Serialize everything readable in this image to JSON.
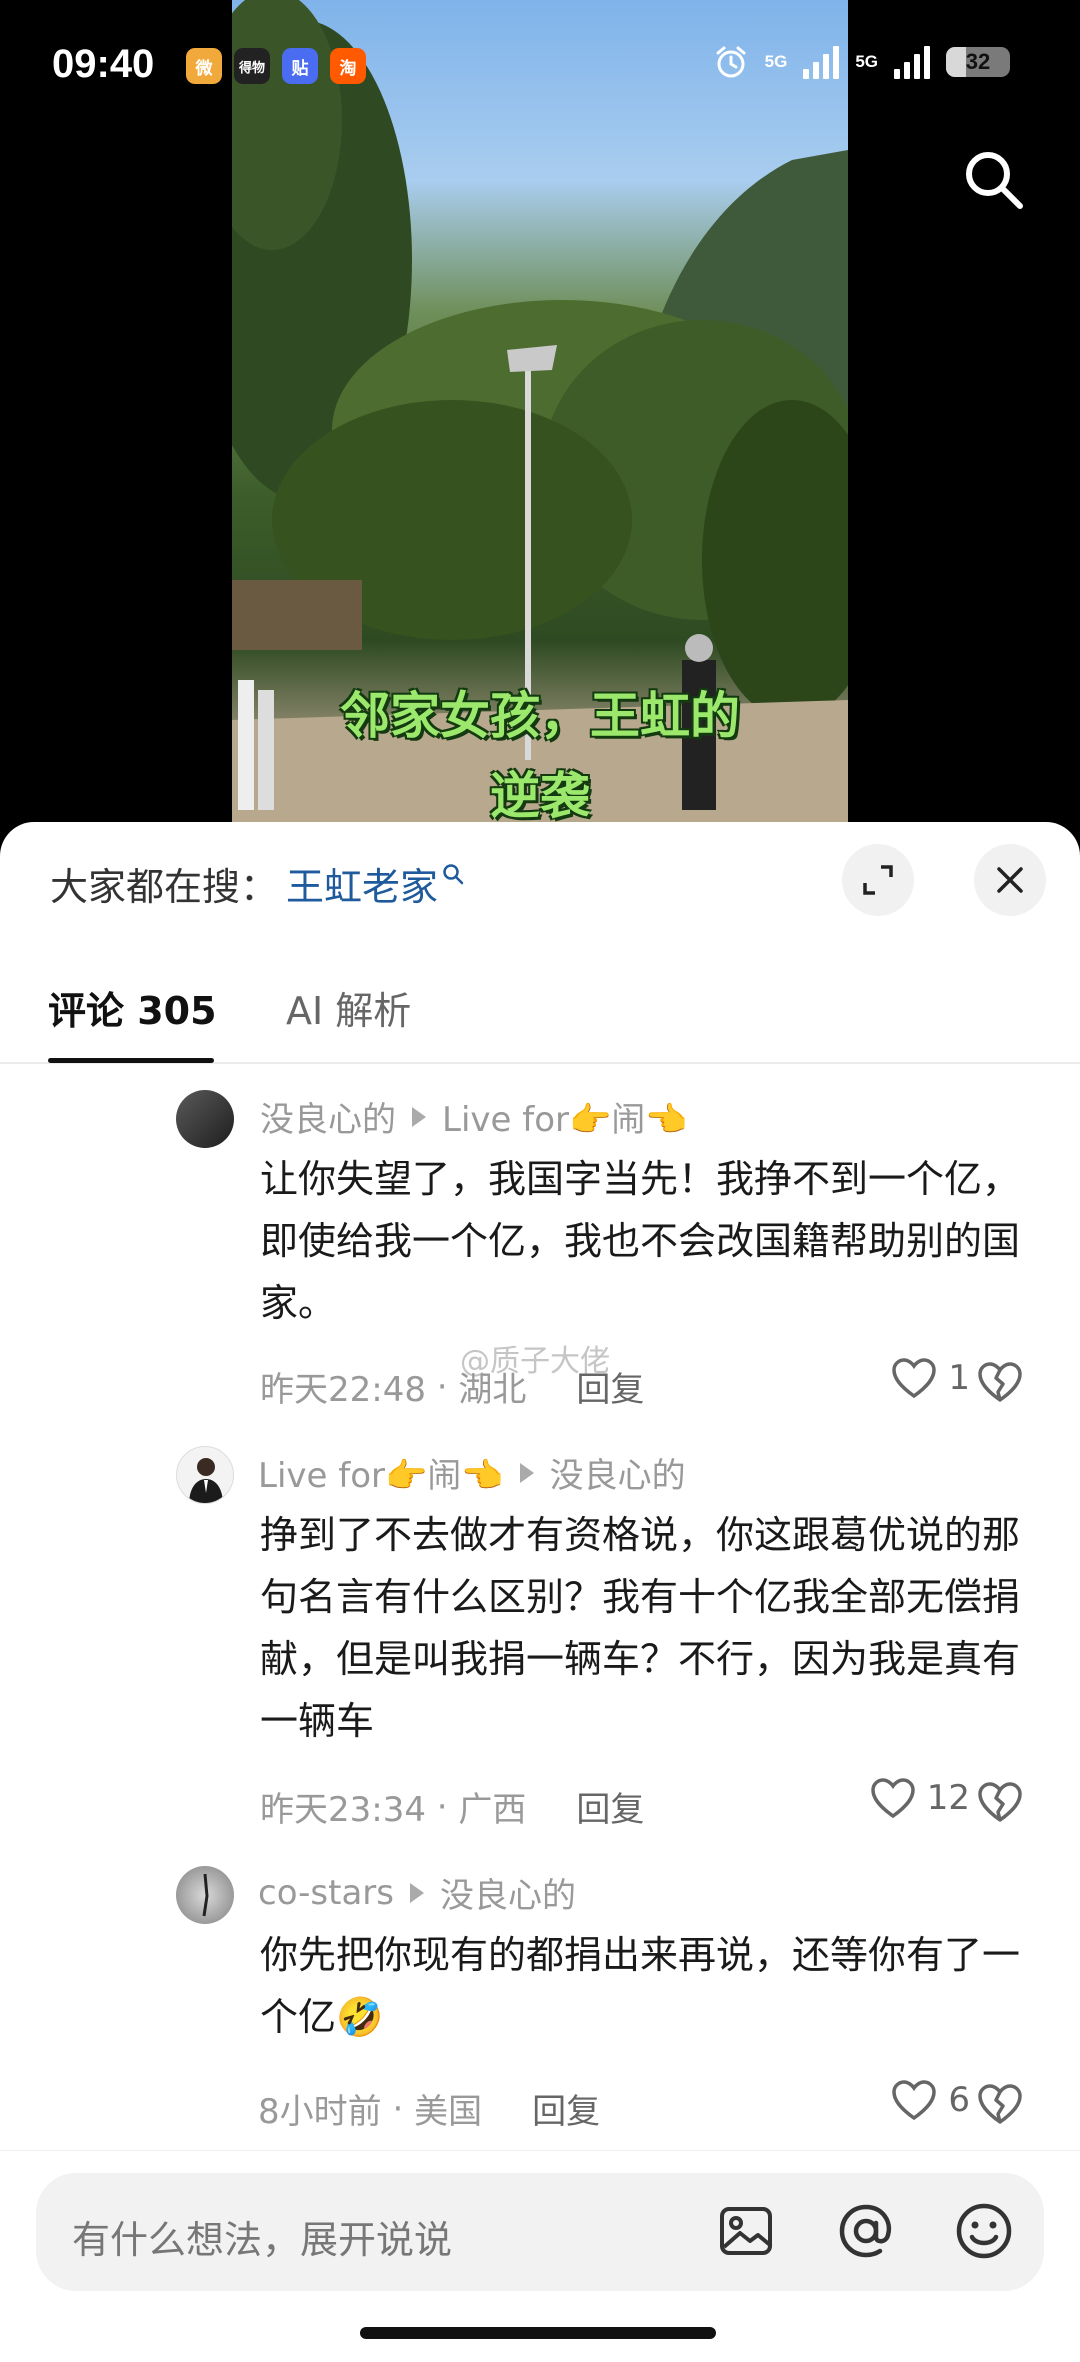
{
  "status_bar": {
    "time": "09:40",
    "apps": [
      {
        "icon": "weibo-icon",
        "label": "微",
        "color": "#f2a93b"
      },
      {
        "icon": "dewu-icon",
        "label": "得物",
        "color": "#222222"
      },
      {
        "icon": "tieba-icon",
        "label": "贴",
        "color": "#4a6cf0"
      },
      {
        "icon": "taobao-icon",
        "label": "淘",
        "color": "#ff5a00"
      }
    ],
    "network_1": "5G",
    "network_2": "5G",
    "battery": "32",
    "battery_level": 0.32
  },
  "video": {
    "subtitle_line1": "邻家女孩，王虹的",
    "subtitle_line2": "逆袭"
  },
  "sheet": {
    "hot_search_label": "大家都在搜：",
    "hot_search_keyword": "王虹老家",
    "tabs": {
      "comments": "评论 305",
      "ai": "AI 解析"
    },
    "watermark": "@质子大佬",
    "comments": [
      {
        "author": "没良心的",
        "reply_to": "Live for👉闹👈",
        "text": "让你失望了，我国字当先！我挣不到一个亿，即使给我一个亿，我也不会改国籍帮助别的国家。",
        "time": "昨天22:48",
        "location": "湖北",
        "reply_label": "回复",
        "likes": "1"
      },
      {
        "author": "Live for👉闹👈",
        "reply_to": "没良心的",
        "text": "挣到了不去做才有资格说，你这跟葛优说的那句名言有什么区别？我有十个亿我全部无偿捐献，但是叫我捐一辆车？不行，因为我是真有一辆车",
        "time": "昨天23:34",
        "location": "广西",
        "reply_label": "回复",
        "likes": "12"
      },
      {
        "author": "co-stars",
        "reply_to": "没良心的",
        "text": "你先把你现有的都捐出来再说，还等你有了一个亿🤣",
        "time": "8小时前",
        "location": "美国",
        "reply_label": "回复",
        "likes": "6"
      }
    ]
  },
  "input": {
    "placeholder": "有什么想法，展开说说"
  }
}
